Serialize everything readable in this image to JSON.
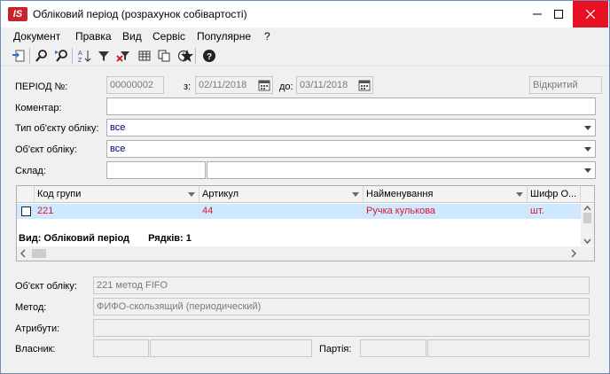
{
  "window": {
    "title": "Обліковий період (розрахунок собівартості)",
    "app_icon": "IS"
  },
  "menu": [
    "Документ",
    "Правка",
    "Вид",
    "Сервіс",
    "Популярне",
    "?"
  ],
  "toolbar": {
    "icons": [
      "document-arrow-icon",
      "search-icon",
      "search-next-icon",
      "sort-az-icon",
      "filter-icon",
      "clear-filter-icon",
      "table-icon",
      "copy-icon",
      "history-icon",
      "star-icon",
      "help-icon"
    ]
  },
  "header": {
    "period_label": "ПЕРІОД №:",
    "period_value": "00000002",
    "from_label": "з:",
    "from_value": "02/11/2018",
    "to_label": "до:",
    "to_value": "03/11/2018",
    "status_value": "Відкритий",
    "comment_label": "Коментар:",
    "comment_value": "",
    "object_type_label": "Тип об'єкту обліку:",
    "object_type_value": "все",
    "object_label": "Об'єкт обліку:",
    "object_value": "все",
    "warehouse_label": "Склад:",
    "warehouse_code": "",
    "warehouse_name": ""
  },
  "grid": {
    "columns": [
      "Код групи",
      "Артикул",
      "Найменування",
      "Шифр О..."
    ],
    "rows": [
      {
        "code": "221",
        "article": "44",
        "name": "Ручка кулькова",
        "unit": "шт."
      }
    ],
    "status_view": "Вид: Обліковий період",
    "status_rows": "Рядків: 1"
  },
  "details": {
    "object_label": "Об'єкт обліку:",
    "object_value": "221 метод FIFO",
    "method_label": "Метод:",
    "method_value": "ФИФО-скользящий (периодический)",
    "attributes_label": "Атрибути:",
    "attributes_value": "",
    "owner_label": "Власник:",
    "owner_code": "",
    "owner_name": "",
    "batch_label": "Партія:",
    "batch_code": "",
    "batch_name": ""
  },
  "colors": {
    "accent_red": "#c8242b",
    "row_selected": "#cde8ff",
    "row_text": "#e0142a",
    "close_button": "#e81123",
    "combo_text": "#000080"
  }
}
